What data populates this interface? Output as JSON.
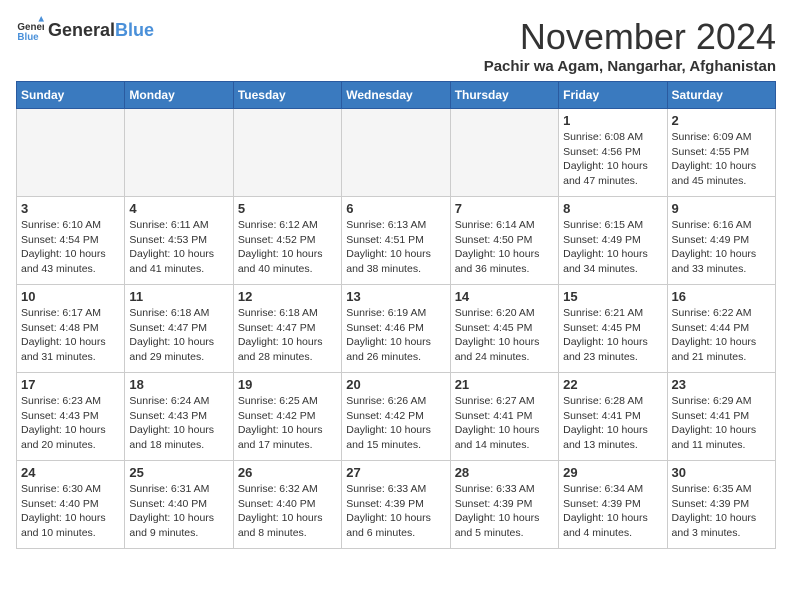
{
  "header": {
    "logo_general": "General",
    "logo_blue": "Blue",
    "month_title": "November 2024",
    "subtitle": "Pachir wa Agam, Nangarhar, Afghanistan"
  },
  "days_of_week": [
    "Sunday",
    "Monday",
    "Tuesday",
    "Wednesday",
    "Thursday",
    "Friday",
    "Saturday"
  ],
  "weeks": [
    [
      {
        "day": "",
        "info": ""
      },
      {
        "day": "",
        "info": ""
      },
      {
        "day": "",
        "info": ""
      },
      {
        "day": "",
        "info": ""
      },
      {
        "day": "",
        "info": ""
      },
      {
        "day": "1",
        "info": "Sunrise: 6:08 AM\nSunset: 4:56 PM\nDaylight: 10 hours and 47 minutes."
      },
      {
        "day": "2",
        "info": "Sunrise: 6:09 AM\nSunset: 4:55 PM\nDaylight: 10 hours and 45 minutes."
      }
    ],
    [
      {
        "day": "3",
        "info": "Sunrise: 6:10 AM\nSunset: 4:54 PM\nDaylight: 10 hours and 43 minutes."
      },
      {
        "day": "4",
        "info": "Sunrise: 6:11 AM\nSunset: 4:53 PM\nDaylight: 10 hours and 41 minutes."
      },
      {
        "day": "5",
        "info": "Sunrise: 6:12 AM\nSunset: 4:52 PM\nDaylight: 10 hours and 40 minutes."
      },
      {
        "day": "6",
        "info": "Sunrise: 6:13 AM\nSunset: 4:51 PM\nDaylight: 10 hours and 38 minutes."
      },
      {
        "day": "7",
        "info": "Sunrise: 6:14 AM\nSunset: 4:50 PM\nDaylight: 10 hours and 36 minutes."
      },
      {
        "day": "8",
        "info": "Sunrise: 6:15 AM\nSunset: 4:49 PM\nDaylight: 10 hours and 34 minutes."
      },
      {
        "day": "9",
        "info": "Sunrise: 6:16 AM\nSunset: 4:49 PM\nDaylight: 10 hours and 33 minutes."
      }
    ],
    [
      {
        "day": "10",
        "info": "Sunrise: 6:17 AM\nSunset: 4:48 PM\nDaylight: 10 hours and 31 minutes."
      },
      {
        "day": "11",
        "info": "Sunrise: 6:18 AM\nSunset: 4:47 PM\nDaylight: 10 hours and 29 minutes."
      },
      {
        "day": "12",
        "info": "Sunrise: 6:18 AM\nSunset: 4:47 PM\nDaylight: 10 hours and 28 minutes."
      },
      {
        "day": "13",
        "info": "Sunrise: 6:19 AM\nSunset: 4:46 PM\nDaylight: 10 hours and 26 minutes."
      },
      {
        "day": "14",
        "info": "Sunrise: 6:20 AM\nSunset: 4:45 PM\nDaylight: 10 hours and 24 minutes."
      },
      {
        "day": "15",
        "info": "Sunrise: 6:21 AM\nSunset: 4:45 PM\nDaylight: 10 hours and 23 minutes."
      },
      {
        "day": "16",
        "info": "Sunrise: 6:22 AM\nSunset: 4:44 PM\nDaylight: 10 hours and 21 minutes."
      }
    ],
    [
      {
        "day": "17",
        "info": "Sunrise: 6:23 AM\nSunset: 4:43 PM\nDaylight: 10 hours and 20 minutes."
      },
      {
        "day": "18",
        "info": "Sunrise: 6:24 AM\nSunset: 4:43 PM\nDaylight: 10 hours and 18 minutes."
      },
      {
        "day": "19",
        "info": "Sunrise: 6:25 AM\nSunset: 4:42 PM\nDaylight: 10 hours and 17 minutes."
      },
      {
        "day": "20",
        "info": "Sunrise: 6:26 AM\nSunset: 4:42 PM\nDaylight: 10 hours and 15 minutes."
      },
      {
        "day": "21",
        "info": "Sunrise: 6:27 AM\nSunset: 4:41 PM\nDaylight: 10 hours and 14 minutes."
      },
      {
        "day": "22",
        "info": "Sunrise: 6:28 AM\nSunset: 4:41 PM\nDaylight: 10 hours and 13 minutes."
      },
      {
        "day": "23",
        "info": "Sunrise: 6:29 AM\nSunset: 4:41 PM\nDaylight: 10 hours and 11 minutes."
      }
    ],
    [
      {
        "day": "24",
        "info": "Sunrise: 6:30 AM\nSunset: 4:40 PM\nDaylight: 10 hours and 10 minutes."
      },
      {
        "day": "25",
        "info": "Sunrise: 6:31 AM\nSunset: 4:40 PM\nDaylight: 10 hours and 9 minutes."
      },
      {
        "day": "26",
        "info": "Sunrise: 6:32 AM\nSunset: 4:40 PM\nDaylight: 10 hours and 8 minutes."
      },
      {
        "day": "27",
        "info": "Sunrise: 6:33 AM\nSunset: 4:39 PM\nDaylight: 10 hours and 6 minutes."
      },
      {
        "day": "28",
        "info": "Sunrise: 6:33 AM\nSunset: 4:39 PM\nDaylight: 10 hours and 5 minutes."
      },
      {
        "day": "29",
        "info": "Sunrise: 6:34 AM\nSunset: 4:39 PM\nDaylight: 10 hours and 4 minutes."
      },
      {
        "day": "30",
        "info": "Sunrise: 6:35 AM\nSunset: 4:39 PM\nDaylight: 10 hours and 3 minutes."
      }
    ]
  ]
}
